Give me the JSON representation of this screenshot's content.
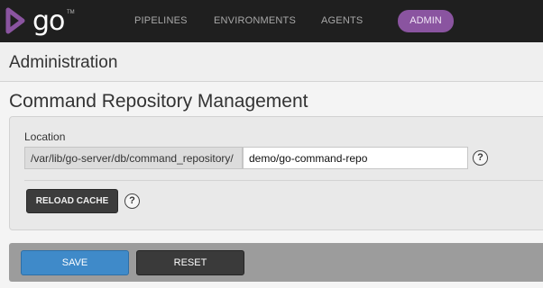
{
  "app": {
    "logo_text": "go",
    "logo_tm": "TM",
    "brand_color": "#8a54a0"
  },
  "nav": {
    "items": [
      {
        "label": "PIPELINES"
      },
      {
        "label": "ENVIRONMENTS"
      },
      {
        "label": "AGENTS"
      },
      {
        "label": "ADMIN",
        "active": true
      }
    ]
  },
  "header": {
    "title": "Administration"
  },
  "main": {
    "title": "Command Repository Management",
    "location_label": "Location",
    "location_prefix": "/var/lib/go-server/db/command_repository/",
    "location_value": "demo/go-command-repo",
    "help_glyph": "?",
    "reload_label": "RELOAD CACHE"
  },
  "footer": {
    "save_label": "SAVE",
    "reset_label": "RESET",
    "save_color": "#3f8ac9"
  },
  "icons": [
    "go-logo-icon",
    "help-icon"
  ]
}
